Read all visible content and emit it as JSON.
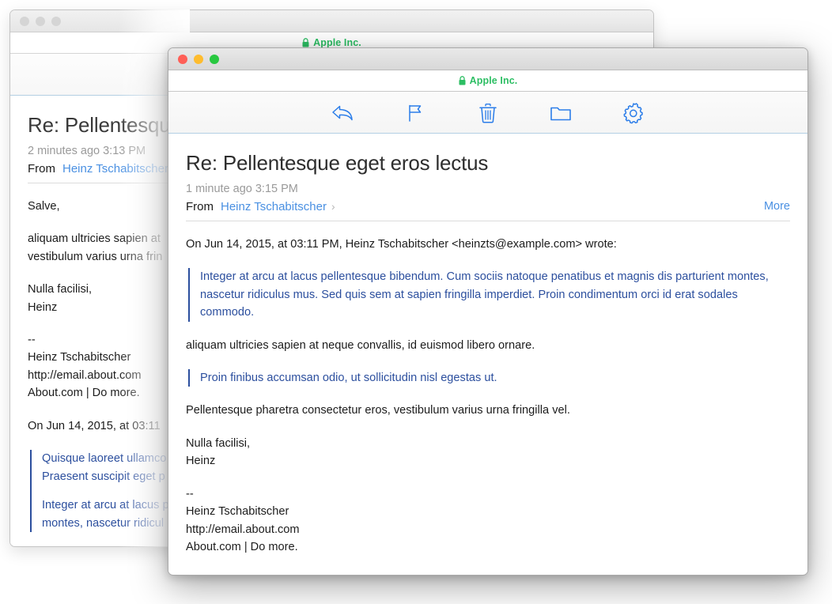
{
  "back_window": {
    "traffic_lights": [
      "close",
      "minimize",
      "zoom"
    ],
    "urlbar": {
      "lock_icon": "lock-icon",
      "site_name": "Apple Inc."
    },
    "toolbar": [
      {
        "name": "reply-button",
        "icon": "reply-arrow-icon"
      },
      {
        "name": "flag-button",
        "icon": "flag-icon"
      },
      {
        "name": "delete-button",
        "icon": "trash-icon"
      },
      {
        "name": "move-button",
        "icon": "folder-icon"
      },
      {
        "name": "settings-button",
        "icon": "gear-icon"
      }
    ],
    "mail": {
      "subject": "Re: Pellentesque",
      "timestamp": "2 minutes ago 3:13 PM",
      "from_label": "From",
      "from_name": "Heinz Tschabitscher",
      "greeting": "Salve,",
      "para1_line1": "aliquam ultricies sapien at",
      "para1_line2": "vestibulum varius urna frin",
      "signoff_line1": "Nulla facilisi,",
      "signoff_line2": "Heinz",
      "sig_dashes": "--",
      "sig_name": "Heinz Tschabitscher",
      "sig_url": "http://email.about.com",
      "sig_tagline": "About.com | Do more.",
      "quote_intro": "On Jun 14, 2015, at 03:11",
      "quote1_line1": "Quisque laoreet ullamco",
      "quote1_line2": "Praesent suscipit eget p",
      "quote2_line1": "Integer at arcu at lacus p",
      "quote2_line2": "montes, nascetur ridicul"
    }
  },
  "front_window": {
    "traffic_lights": [
      "close",
      "minimize",
      "zoom"
    ],
    "urlbar": {
      "lock_icon": "lock-icon",
      "site_name": "Apple Inc."
    },
    "toolbar": [
      {
        "name": "reply-button",
        "icon": "reply-arrow-icon"
      },
      {
        "name": "flag-button",
        "icon": "flag-icon"
      },
      {
        "name": "delete-button",
        "icon": "trash-icon"
      },
      {
        "name": "move-button",
        "icon": "folder-icon"
      },
      {
        "name": "settings-button",
        "icon": "gear-icon"
      }
    ],
    "mail": {
      "subject": "Re: Pellentesque eget eros lectus",
      "timestamp": "1 minute ago 3:15 PM",
      "from_label": "From",
      "from_name": "Heinz Tschabitscher",
      "more_label": "More",
      "quote_intro": "On Jun 14, 2015, at 03:11 PM, Heinz Tschabitscher <heinzts@example.com> wrote:",
      "quote1": "Integer at arcu at lacus pellentesque bibendum. Cum sociis natoque penatibus et magnis dis parturient montes, nascetur ridiculus mus. Sed quis sem at sapien fringilla imperdiet. Proin condimentum orci id erat sodales commodo.",
      "para1": "aliquam ultricies sapien at neque convallis, id euismod libero ornare.",
      "quote2": "Proin finibus accumsan odio, ut sollicitudin nisl egestas ut.",
      "para2": "Pellentesque pharetra consectetur eros, vestibulum varius urna fringilla vel.",
      "signoff_line1": "Nulla facilisi,",
      "signoff_line2": "Heinz",
      "sig_dashes": "--",
      "sig_name": "Heinz Tschabitscher",
      "sig_url": "http://email.about.com",
      "sig_tagline": "About.com | Do more."
    }
  },
  "colors": {
    "accent_blue": "#4a90e2",
    "quote_blue": "#2c4f9e",
    "secure_green": "#2cbe63",
    "light_red": "#ff5f57",
    "light_yellow": "#febc2e",
    "light_green": "#28c840",
    "light_inactive": "#d5d5d5"
  }
}
